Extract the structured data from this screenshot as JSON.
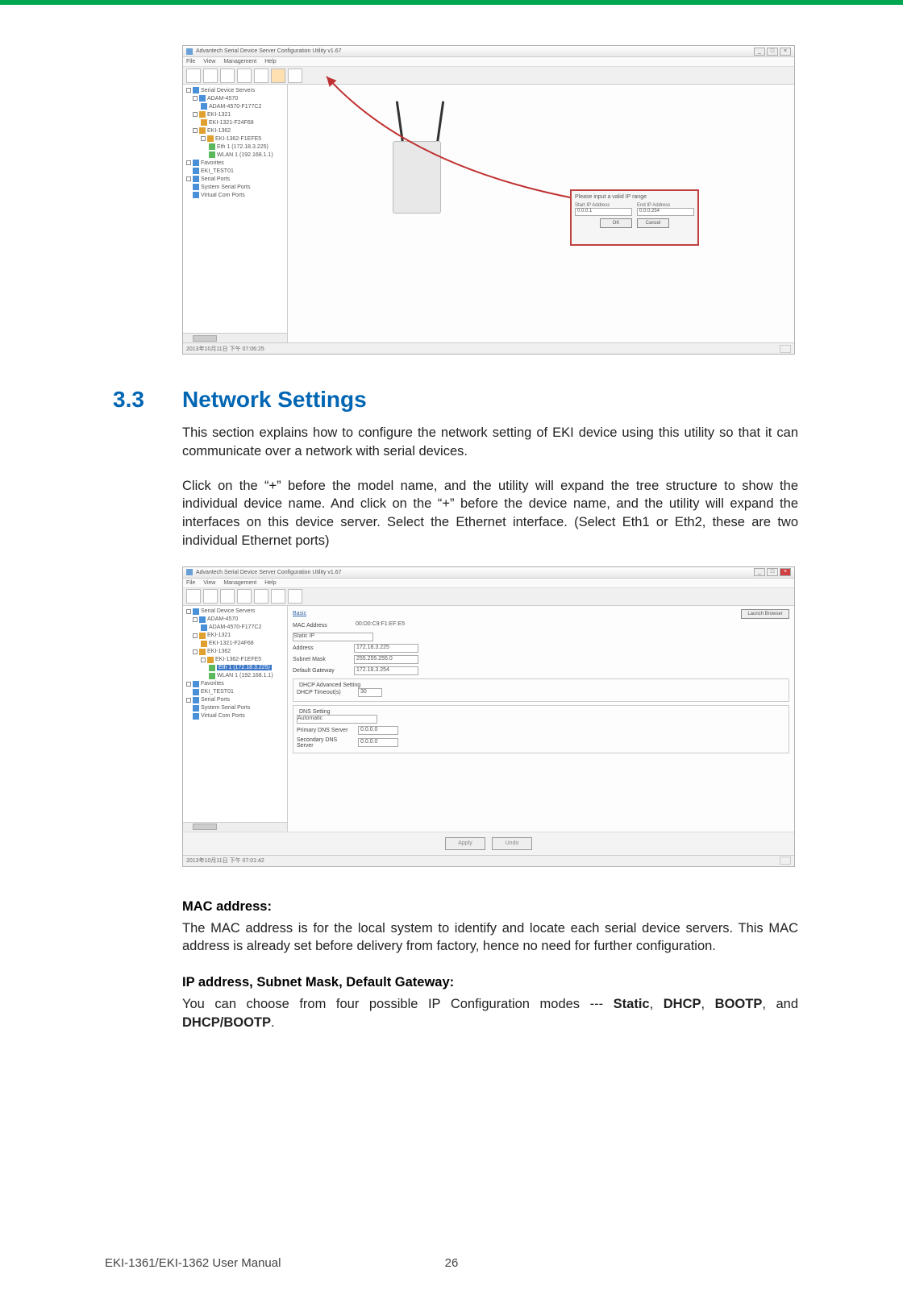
{
  "section": {
    "num": "3.3",
    "title": "Network Settings"
  },
  "para1": "This section explains how to configure the network setting of EKI device using this utility so that it can communicate over a network with serial devices.",
  "para2": "Click on the “+” before the model name, and the utility will expand the tree structure to show the individual device name. And click on the “+” before the device name, and the utility will expand the interfaces on this device server. Select the Ethernet interface. (Select Eth1 or Eth2, these are two individual Ethernet ports)",
  "mac_head": "MAC address:",
  "mac_body": "The MAC address is for the local system to identify and locate each serial device servers. This MAC address is already set before delivery from factory, hence no need for further configuration.",
  "ip_head": "IP address, Subnet Mask, Default Gateway:",
  "ip_body_a": "You can choose from four possible IP Configuration modes --- ",
  "ip_body_b": "Static",
  "ip_body_c": ", ",
  "ip_body_d": "DHCP",
  "ip_body_e": ", ",
  "ip_body_f": "BOOTP",
  "ip_body_g": ", and ",
  "ip_body_h": "DHCP/BOOTP",
  "ip_body_i": ".",
  "footer": {
    "left": "EKI-1361/EKI-1362 User Manual",
    "page": "26"
  },
  "win": {
    "title": "Advantech Serial Device Server Configuration Utility v1.67",
    "menus": [
      "File",
      "View",
      "Management",
      "Help"
    ],
    "status": "2013年10月11日  下午 07:06:25",
    "tree": {
      "root1": "Serial Device Servers",
      "i1": "ADAM-4570",
      "i2": "ADAM-4570-F177C2",
      "i3": "EKI-1321",
      "i4": "EKI-1321-F24F68",
      "i5": "EKI-1362",
      "i6": "EKI-1362-F1EFE5",
      "i7": "Eth 1 (172.18.3.225)",
      "i8": "WLAN 1 (192.168.1.1)",
      "root2": "Favorites",
      "f1": "EKI_TEST01",
      "root3": "Serial Ports",
      "s1": "System Serial Ports",
      "s2": "Virtual Com Ports"
    }
  },
  "dialog": {
    "prompt": "Please input a valid IP range",
    "c1": "Start IP Address",
    "c2": "End IP Address",
    "v1": "0.0.0.1",
    "v2": "0.0.0.254",
    "ok": "OK",
    "cancel": "Cancel"
  },
  "form": {
    "basic": "Basic",
    "launch": "Launch Browser",
    "mac_lbl": "MAC Address",
    "mac_val": "00:D0:C9:F1:EF:E5",
    "static_lbl": "Static IP",
    "addr_lbl": "Address",
    "addr_val": "172.18.3.225",
    "mask_lbl": "Subnet Mask",
    "mask_val": "255.255.255.0",
    "gw_lbl": "Default Gateway",
    "gw_val": "172.18.3.254",
    "dhcp_grp": "DHCP Advanced Setting",
    "dhcp_to_lbl": "DHCP Timeout(s)",
    "dhcp_to_val": "30",
    "dns_grp": "DNS Setting",
    "dns_auto": "Automatic",
    "dns1_lbl": "Primary DNS Server",
    "dns1_val": "0.0.0.0",
    "dns2_lbl": "Secondary DNS Server",
    "dns2_val": "0.0.0.0",
    "apply": "Apply",
    "undo": "Undo",
    "status2": "2013年10月11日  下午 07:01:42"
  }
}
